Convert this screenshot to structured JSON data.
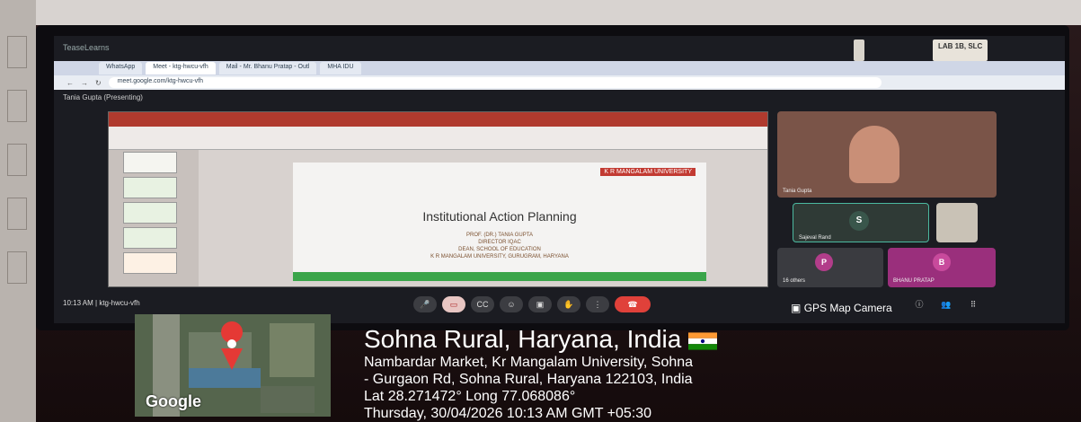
{
  "os": {
    "app_name": "TeaseLearns"
  },
  "stickers": [
    "",
    "LAB 1B, SLC"
  ],
  "browser": {
    "tabs": [
      {
        "label": "WhatsApp",
        "active": false
      },
      {
        "label": "Meet - ktg-hwcu-vfh",
        "active": true
      },
      {
        "label": "Mail - Mr. Bhanu Pratap - Outl",
        "active": false
      },
      {
        "label": "MHA IDU",
        "active": false
      }
    ],
    "url": "meet.google.com/ktg-hwcu-vfh"
  },
  "meet": {
    "presenter_label": "Tania Gupta (Presenting)",
    "meeting_info": "10:13 AM  |  ktg-hwcu-vfh",
    "participants": [
      {
        "name": "Tania Gupta"
      },
      {
        "name": "Sajeval Rand",
        "initial": "S"
      },
      {
        "name": "16 others",
        "initial": "P"
      },
      {
        "name": "BHANU PRATAP",
        "initial": "B"
      }
    ]
  },
  "slide": {
    "logo_text": "K R MANGALAM UNIVERSITY",
    "title": "Institutional Action Planning",
    "lines": [
      "PROF. (DR.) TANIA GUPTA",
      "DIRECTOR IQAC",
      "DEAN, SCHOOL OF EDUCATION",
      "K R MANGALAM UNIVERSITY, GURUGRAM, HARYANA"
    ]
  },
  "gps": {
    "camera_label": "GPS Map Camera",
    "map_brand": "Google",
    "place": "Sohna Rural, Haryana, India",
    "address_line1": "Nambardar Market, Kr Mangalam University, Sohna",
    "address_line2": "- Gurgaon Rd, Sohna Rural, Haryana 122103, India",
    "coords": "Lat 28.271472° Long 77.068086°",
    "datetime": "Thursday, 30/04/2026 10:13 AM GMT +05:30"
  },
  "colors": {
    "end_call": "#e0413a",
    "slide_green": "#3aa54a",
    "slide_logo": "#c23a32"
  }
}
